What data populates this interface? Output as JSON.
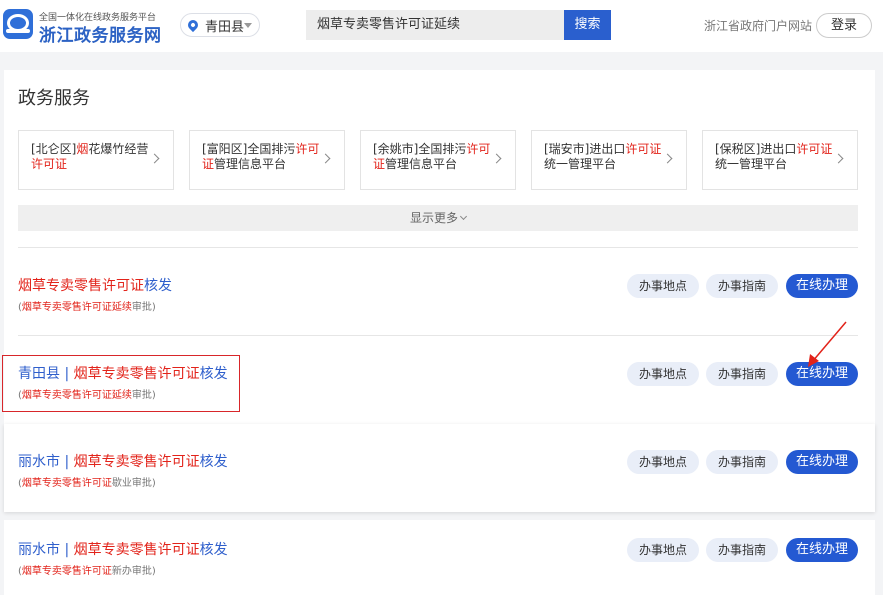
{
  "header": {
    "logo_subtitle": "全国一体化在线政务服务平台",
    "logo_title": "浙江政务服务网",
    "region": "青田县",
    "search_value": "烟草专卖零售许可证延续",
    "search_button": "搜索",
    "portal_link": "浙江省政府门户网站",
    "login_button": "登录"
  },
  "section_title": "政务服务",
  "cards": [
    {
      "pre": "[北仑区]",
      "hl1": "烟",
      "mid": "花爆竹经营",
      "hl2": "许可证",
      "post": ""
    },
    {
      "pre": "[富阳区]全国排污",
      "hl1": "许可证",
      "mid": "管理信息平台",
      "hl2": "",
      "post": ""
    },
    {
      "pre": "[余姚市]全国排污",
      "hl1": "许可证",
      "mid": "管理信息平台",
      "hl2": "",
      "post": ""
    },
    {
      "pre": "[瑞安市]进出口",
      "hl1": "许可证",
      "mid": "统一管理平台",
      "hl2": "",
      "post": ""
    },
    {
      "pre": "[保税区]进出口",
      "hl1": "许可证",
      "mid": "统一管理平台",
      "hl2": "",
      "post": ""
    }
  ],
  "show_more": "显示更多",
  "actions": {
    "location": "办事地点",
    "guide": "办事指南",
    "online": "在线办理"
  },
  "results": [
    {
      "prefix": "",
      "title_red": "烟草专卖零售许可证",
      "title_rest": "核发",
      "sub_open": "(",
      "sub_red": "烟草专卖零售许可证延续",
      "sub_rest": "审批)"
    },
    {
      "prefix": "青田县 | ",
      "title_red": "烟草专卖零售许可证",
      "title_rest": "核发",
      "sub_open": "(",
      "sub_red": "烟草专卖零售许可证延续",
      "sub_rest": "审批)"
    },
    {
      "prefix": "丽水市 | ",
      "title_red": "烟草专卖零售许可证",
      "title_rest": "核发",
      "sub_open": "(",
      "sub_red": "烟草专卖零售许可证",
      "sub_rest": "歇业审批)"
    },
    {
      "prefix": "丽水市 | ",
      "title_red": "烟草专卖零售许可证",
      "title_rest": "核发",
      "sub_open": "(",
      "sub_red": "烟草专卖零售许可证",
      "sub_rest": "新办审批)"
    }
  ]
}
